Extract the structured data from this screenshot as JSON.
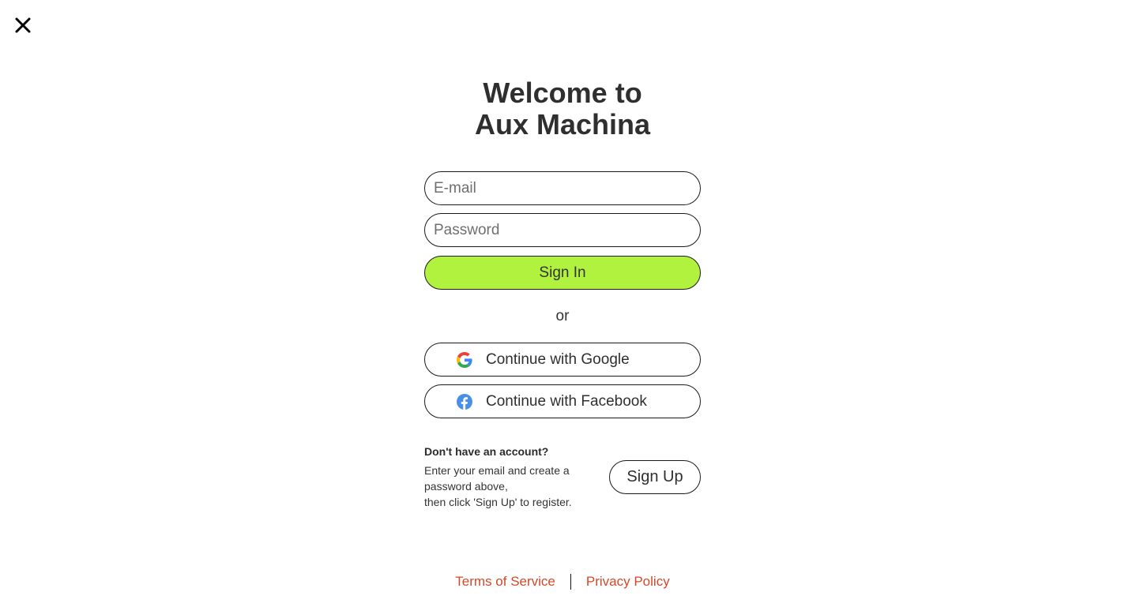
{
  "dialog": {
    "close_icon": "close-icon",
    "title_line1": "Welcome to",
    "title_line2": "Aux Machina"
  },
  "form": {
    "email": {
      "value": "",
      "placeholder": "E-mail"
    },
    "password": {
      "value": "",
      "placeholder": "Password"
    },
    "sign_in_label": "Sign In",
    "sign_in_color": "#b0f23e",
    "separator": "or"
  },
  "social": {
    "google": {
      "icon": "google-icon",
      "label": "Continue with Google"
    },
    "facebook": {
      "icon": "facebook-icon",
      "label": "Continue with Facebook"
    }
  },
  "signup": {
    "heading": "Don't have an account?",
    "desc_line1": "Enter your email and create a",
    "desc_line2": "password above,",
    "desc_line3": "then click 'Sign Up' to register.",
    "button_label": "Sign Up"
  },
  "footer": {
    "terms": "Terms of Service",
    "privacy": "Privacy Policy",
    "link_color": "#d2492a"
  }
}
